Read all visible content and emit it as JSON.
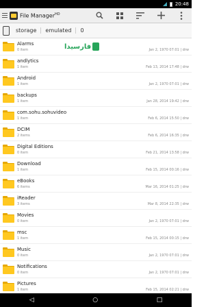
{
  "status": {
    "time": "20:48"
  },
  "appbar": {
    "title": "File Manager",
    "title_sup": "HD"
  },
  "path": {
    "crumbs": [
      "storage",
      "emulated",
      "0"
    ]
  },
  "watermark": {
    "text": "فارسیدا"
  },
  "rows": [
    {
      "name": "Alarms",
      "items": "0 item",
      "meta": "Jan 2, 1970 07:01 | drw"
    },
    {
      "name": "andlytics",
      "items": "1 item",
      "meta": "Feb 13, 2014 17:48 | drw"
    },
    {
      "name": "Android",
      "items": "1 item",
      "meta": "Jan 2, 1970 07:01 | drw"
    },
    {
      "name": "backups",
      "items": "1 item",
      "meta": "Jan 28, 2014 19:42 | drw"
    },
    {
      "name": "com.sohu.sohuvideo",
      "items": "1 item",
      "meta": "Feb 6, 2014 15:50 | drw"
    },
    {
      "name": "DCIM",
      "items": "2 items",
      "meta": "Feb 6, 2014 16:35 | drw"
    },
    {
      "name": "Digital Editions",
      "items": "0 item",
      "meta": "Feb 21, 2014 13:58 | drw"
    },
    {
      "name": "Download",
      "items": "1 item",
      "meta": "Feb 15, 2014 00:16 | drw"
    },
    {
      "name": "eBooks",
      "items": "6 items",
      "meta": "Mar 16, 2014 01:25 | drw"
    },
    {
      "name": "iReader",
      "items": "3 items",
      "meta": "Mar 8, 2014 22:35 | drw"
    },
    {
      "name": "Movies",
      "items": "0 item",
      "meta": "Jan 2, 1970 07:01 | drw"
    },
    {
      "name": "msc",
      "items": "1 item",
      "meta": "Feb 15, 2014 00:15 | drw"
    },
    {
      "name": "Music",
      "items": "0 item",
      "meta": "Jan 2, 1970 07:01 | drw"
    },
    {
      "name": "Notifications",
      "items": "0 item",
      "meta": "Jan 2, 1970 07:01 | drw"
    },
    {
      "name": "Pictures",
      "items": "1 item",
      "meta": "Feb 15, 2014 02:21 | drw"
    }
  ]
}
